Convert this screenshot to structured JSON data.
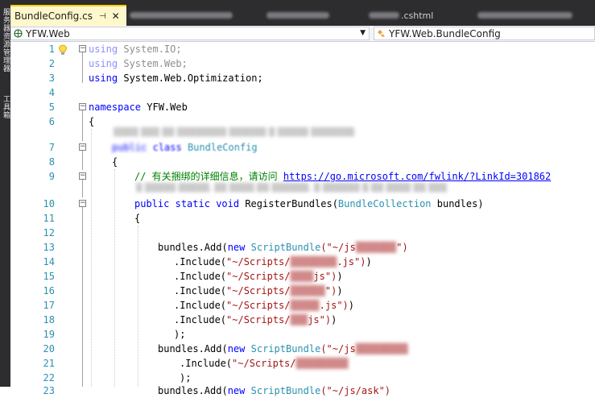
{
  "tabs": {
    "active": {
      "label": "BundleConfig.cs",
      "pin": "⊣",
      "close": "✕"
    },
    "others": [
      {
        "label": ""
      },
      {
        "label": ""
      },
      {
        "label": ".cshtml"
      },
      {
        "label": ""
      }
    ]
  },
  "sidebar": {
    "text1": "服务器资源管理器",
    "text2": "工具箱"
  },
  "navbar": {
    "project": "YFW.Web",
    "class": "YFW.Web.BundleConfig"
  },
  "editor": {
    "lines": [
      {
        "n": "1"
      },
      {
        "n": "2"
      },
      {
        "n": "3"
      },
      {
        "n": "4"
      },
      {
        "n": "5"
      },
      {
        "n": "6"
      },
      {
        "n": "7"
      },
      {
        "n": "8"
      },
      {
        "n": "9"
      },
      {
        "n": "10"
      },
      {
        "n": "11"
      },
      {
        "n": "12"
      },
      {
        "n": "13"
      },
      {
        "n": "14"
      },
      {
        "n": "15"
      },
      {
        "n": "16"
      },
      {
        "n": "17"
      },
      {
        "n": "18"
      },
      {
        "n": "19"
      },
      {
        "n": "20"
      },
      {
        "n": "21"
      },
      {
        "n": "22"
      },
      {
        "n": "23"
      }
    ],
    "code": {
      "l1_kw": "using",
      "l1_rest": " System.IO;",
      "l2_kw": "using",
      "l2_rest": " System.Web;",
      "l3_kw": "using",
      "l3_rest": " System.Web.Optimization;",
      "l5_kw": "namespace",
      "l5_rest": " YFW.Web",
      "l6": "{",
      "l7_kw1": "public",
      "l7_kw2": "class",
      "l7_type": "BundleConfig",
      "l8": "{",
      "l9_comment": "// 有关捆绑的详细信息，请访问 ",
      "l9_link": "https://go.microsoft.com/fwlink/?LinkId=301862",
      "l10_kw1": "public",
      "l10_kw2": "static",
      "l10_kw3": "void",
      "l10_name": " RegisterBundles(",
      "l10_type": "BundleCollection",
      "l10_rest": " bundles)",
      "l11": "{",
      "l13_a": "bundles.Add(",
      "l13_new": "new",
      "l13_type": "ScriptBundle",
      "l13_str": "(\"~/js",
      "l14_a": ".Include(",
      "l14_str": "\"~/Scripts/",
      "l14_end": ".js\")",
      "l15_a": ".Include(",
      "l15_str": "\"~/Scripts/",
      "l15_end": "js\")",
      "l16_a": ".Include(",
      "l16_str": "\"~/Scripts/",
      "l16_end": "\")",
      "l17_a": ".Include(",
      "l17_str": "\"~/Scripts/",
      "l17_end": ".js\")",
      "l18_a": ".Include(",
      "l18_str": "\"~/Scripts/",
      "l18_end": "js\")",
      "l19": ");",
      "l20_a": "bundles.Add(",
      "l20_new": "new",
      "l20_type": "ScriptBundle",
      "l20_str": "(\"~/js",
      "l21_a": ".Include(",
      "l21_str": "\"~/Scripts/",
      "l22": ");",
      "l23_a": "bundles.Add(",
      "l23_new": "new",
      "l23_type": "ScriptBundle",
      "l23_str": "(\"~/js/ask\")"
    }
  },
  "colors": {
    "keyword": "#0000ff",
    "type": "#2b91af",
    "string": "#a31515",
    "comment": "#008000",
    "accent": "#ffcc00"
  }
}
